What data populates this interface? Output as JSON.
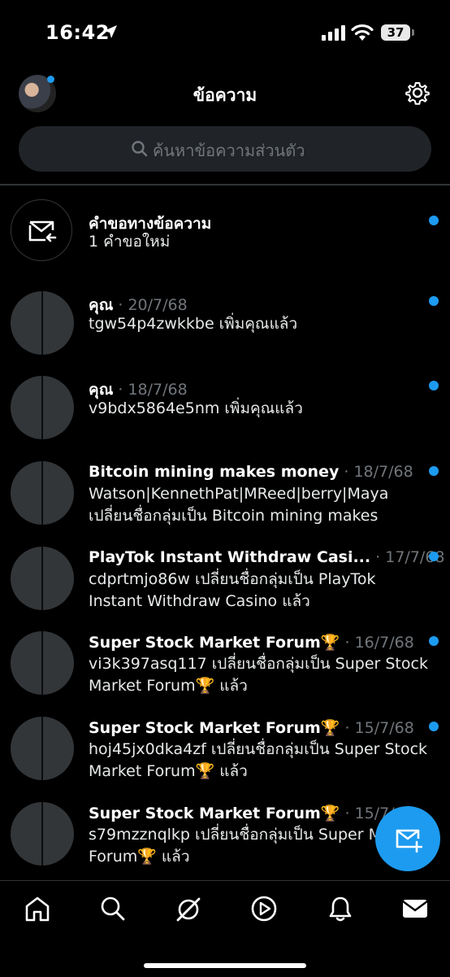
{
  "status_bar": {
    "time": "16:42",
    "battery": "37"
  },
  "header": {
    "title": "ข้อความ"
  },
  "search": {
    "placeholder": "ค้นหาข้อความส่วนตัว"
  },
  "requests": {
    "title": "คำขอทางข้อความ",
    "subtitle": "1 คำขอใหม่"
  },
  "conversations": [
    {
      "name": "คุณ",
      "date": "· 20/7/68",
      "preview": "tgw54p4zwkkbe เพิ่มคุณแล้ว",
      "unread": true
    },
    {
      "name": "คุณ",
      "date": "· 18/7/68",
      "preview": "v9bdx5864e5nm เพิ่มคุณแล้ว",
      "unread": true
    },
    {
      "name": "Bitcoin mining makes money",
      "date": "· 18/7/68",
      "preview": "Watson|KennethPat|MReed|berry|Maya เปลี่ยนชื่อกลุ่มเป็น Bitcoin mining makes",
      "unread": true
    },
    {
      "name": "PlayTok Instant Withdraw Casi...",
      "date": "· 17/7/68",
      "preview": "cdprtmjo86w เปลี่ยนชื่อกลุ่มเป็น PlayTok Instant Withdraw Casino แล้ว",
      "unread": true
    },
    {
      "name": "Super Stock Market Forum🏆",
      "date": "· 16/7/68",
      "preview": "vi3k397asq117 เปลี่ยนชื่อกลุ่มเป็น Super Stock Market Forum🏆 แล้ว",
      "unread": true
    },
    {
      "name": "Super Stock Market Forum🏆",
      "date": "· 15/7/68",
      "preview": "hoj45jx0dka4zf เปลี่ยนชื่อกลุ่มเป็น Super Stock Market Forum🏆 แล้ว",
      "unread": true
    },
    {
      "name": "Super Stock Market Forum🏆",
      "date": "· 15/7/68",
      "preview": "s79mzznqlkp เปลี่ยนชื่อกลุ่มเป็น Super Market Forum🏆 แล้ว",
      "unread": false
    }
  ],
  "nav": [
    "home-icon",
    "search-icon",
    "grok-icon",
    "video-icon",
    "notifications-icon",
    "messages-icon"
  ],
  "colors": {
    "accent": "#1d9bf0",
    "background": "#000000",
    "muted": "#71767b"
  }
}
